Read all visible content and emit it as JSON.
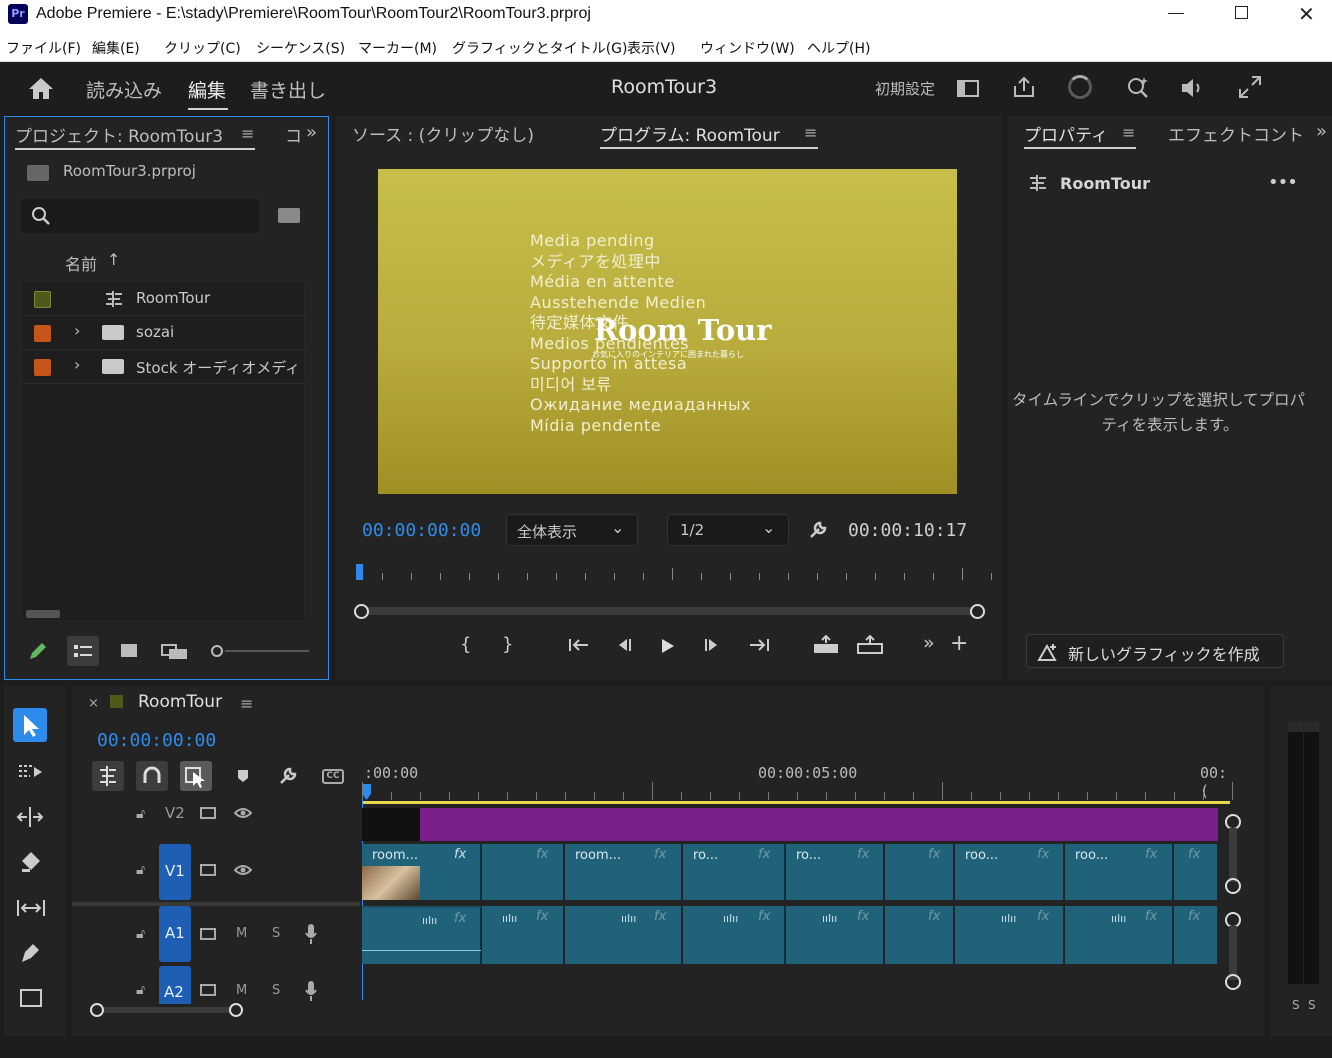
{
  "window": {
    "app_icon": "Pr",
    "title": "Adobe Premiere - E:\\stady\\Premiere\\RoomTour\\RoomTour2\\RoomTour3.prproj"
  },
  "menu": [
    "ファイル(F)",
    "編集(E)",
    "クリップ(C)",
    "シーケンス(S)",
    "マーカー(M)",
    "グラフィックとタイトル(G)",
    "表示(V)",
    "ウィンドウ(W)",
    "ヘルプ(H)"
  ],
  "header": {
    "tabs": [
      "読み込み",
      "編集",
      "書き出し"
    ],
    "active_tab": "編集",
    "project_name": "RoomTour3",
    "workspace": "初期設定"
  },
  "project_panel": {
    "tab_label": "プロジェクト: RoomTour3",
    "next_tab_label": "コ",
    "file_name": "RoomTour3.prproj",
    "search_placeholder": "",
    "column_name": "名前",
    "items": [
      {
        "label": "RoomTour",
        "type": "sequence",
        "color": "#4d5a1c"
      },
      {
        "label": "sozai",
        "type": "bin",
        "color": "#c4561b"
      },
      {
        "label": "Stock オーディオメディ",
        "type": "bin",
        "color": "#c4561b"
      }
    ]
  },
  "monitor": {
    "source_tab": "ソース : (クリップなし)",
    "program_tab": "プログラム: RoomTour",
    "pending_lines": [
      "Media pending",
      "メディアを処理中",
      "Média en attente",
      "Ausstehende Medien",
      "待定媒体文件",
      "Medios pendientes",
      "Supporto in attesa",
      "미디어 보류",
      "Ожидание медиаданных",
      "Mídia pendente"
    ],
    "overlay_title": "Room Tour",
    "overlay_subtitle": "お気に入りのインテリアに囲まれた暮らし",
    "current_timecode": "00:00:00:00",
    "zoom": "全体表示",
    "resolution": "1/2",
    "duration": "00:00:10:17"
  },
  "properties_panel": {
    "tab_label": "プロパティ",
    "second_tab": "エフェクトコント",
    "item_name": "RoomTour",
    "hint_line1": "タイムラインでクリップを選択してプロパ",
    "hint_line2": "ティを表示します。",
    "new_graphic_button": "新しいグラフィックを作成"
  },
  "timeline": {
    "sequence_name": "RoomTour",
    "timecode": "00:00:00:00",
    "ruler_labels": [
      ":00:00",
      "00:00:05:00",
      "00:("
    ],
    "tracks": {
      "v2": "V2",
      "v1": "V1",
      "a1": "A1",
      "a2": "A2",
      "mute": "M",
      "solo": "S"
    },
    "v1_clips": [
      "room...",
      "",
      "room...",
      "ro...",
      "ro...",
      "",
      "roo...",
      "roo...",
      ""
    ],
    "fx_label": "fx",
    "meter_labels": [
      "S",
      "S"
    ]
  },
  "colors": {
    "accent": "#2d8ceb",
    "title_clip": "#7b1f8c",
    "video_clip": "#20627a",
    "playhead": "#2d8ceb"
  }
}
